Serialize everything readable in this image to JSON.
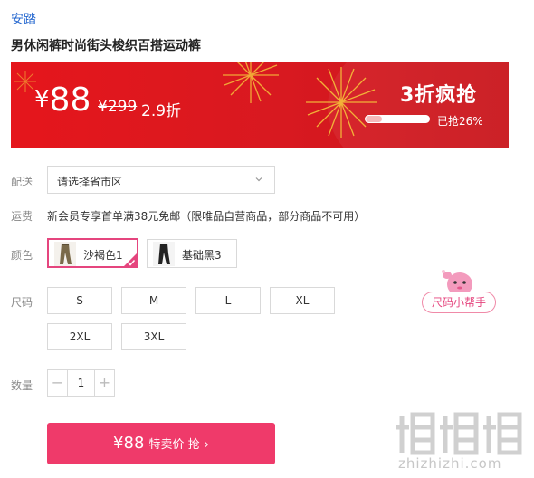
{
  "product": {
    "brand": "安踏",
    "title": "男休闲裤时尚街头梭织百搭运动裤"
  },
  "banner": {
    "currency": "¥",
    "price": "88",
    "original_price": "¥299",
    "discount": "2.9折",
    "sale_title": "3折疯抢",
    "progress_text": "已抢26%",
    "progress_fraction": 0.26,
    "colors": {
      "background": "#e5161c",
      "text": "#ffffff",
      "fireworks": "#f6c23a"
    }
  },
  "delivery": {
    "label": "配送",
    "placeholder": "请选择省市区",
    "icon": "chevron-down-icon"
  },
  "shipping": {
    "label": "运费",
    "text": "新会员专享首单满38元免邮（限唯品自营商品，部分商品不可用）"
  },
  "color": {
    "label": "颜色",
    "options": [
      {
        "label": "沙褐色1",
        "selected": true
      },
      {
        "label": "基础黑3",
        "selected": false
      }
    ],
    "accent": "#e5457e"
  },
  "size": {
    "label": "尺码",
    "options": [
      "S",
      "M",
      "L",
      "XL",
      "2XL",
      "3XL"
    ],
    "helper": "尺码小帮手"
  },
  "quantity": {
    "label": "数量",
    "value": "1",
    "minus": "−",
    "plus": "+"
  },
  "buy": {
    "price": "¥88",
    "text": "特卖价 抢",
    "arrow": "›",
    "color": "#ef3a6a"
  },
  "watermark": {
    "logo": "值值值",
    "site": "zhizhizhi.com"
  }
}
